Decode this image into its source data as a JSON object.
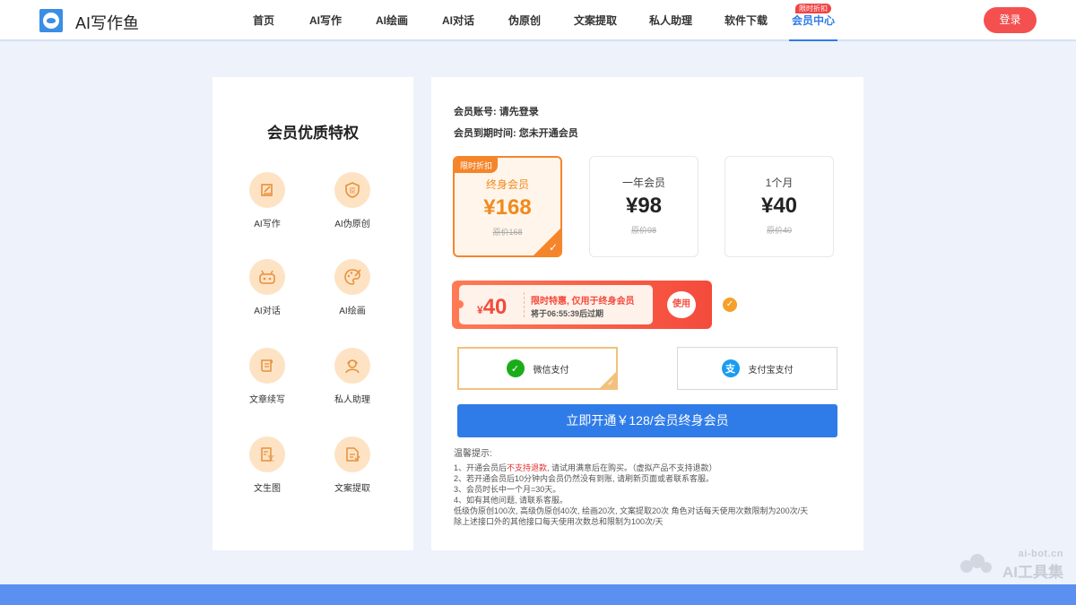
{
  "header": {
    "logo_text": "AI写作鱼",
    "nav": [
      {
        "label": "首页",
        "active": false,
        "badge": ""
      },
      {
        "label": "AI写作",
        "active": false,
        "badge": ""
      },
      {
        "label": "AI绘画",
        "active": false,
        "badge": ""
      },
      {
        "label": "AI对话",
        "active": false,
        "badge": ""
      },
      {
        "label": "伪原创",
        "active": false,
        "badge": ""
      },
      {
        "label": "文案提取",
        "active": false,
        "badge": ""
      },
      {
        "label": "私人助理",
        "active": false,
        "badge": ""
      },
      {
        "label": "软件下载",
        "active": false,
        "badge": ""
      },
      {
        "label": "会员中心",
        "active": true,
        "badge": "限时折扣"
      }
    ],
    "login_label": "登录"
  },
  "privileges": {
    "title": "会员优质特权",
    "items": [
      {
        "label": "AI写作",
        "icon": "pencil-icon"
      },
      {
        "label": "AI伪原创",
        "icon": "shield-original-icon"
      },
      {
        "label": "AI对话",
        "icon": "robot-icon"
      },
      {
        "label": "AI绘画",
        "icon": "palette-icon"
      },
      {
        "label": "文章续写",
        "icon": "scroll-icon"
      },
      {
        "label": "私人助理",
        "icon": "assistant-icon"
      },
      {
        "label": "文生图",
        "icon": "text-image-icon"
      },
      {
        "label": "文案提取",
        "icon": "document-extract-icon"
      }
    ]
  },
  "account": {
    "account_line": "会员账号: 请先登录",
    "expiry_line": "会员到期时间: 您未开通会员"
  },
  "plans": [
    {
      "tag": "限时折扣",
      "name": "终身会员",
      "price": "¥168",
      "original": "原价168",
      "selected": true
    },
    {
      "tag": "",
      "name": "一年会员",
      "price": "¥98",
      "original": "原价98",
      "selected": false
    },
    {
      "tag": "",
      "name": "1个月",
      "price": "¥40",
      "original": "原价40",
      "selected": false
    }
  ],
  "coupon": {
    "currency": "¥",
    "amount": "40",
    "text": "限时特惠, 仅用于终身会员",
    "countdown": "将于06:55:39后过期",
    "use_label": "使用"
  },
  "payment": {
    "wechat_label": "微信支付",
    "alipay_label": "支付宝支付",
    "selected": "wechat"
  },
  "open_button": "立即开通￥128/会员终身会员",
  "tips": {
    "title": "温馨提示:",
    "line1_a": "1、开通会员后",
    "line1_red": "不支持退款",
    "line1_b": ", 请试用满意后在购买。（虚拟产品不支持退款）",
    "line2": "2、若开通会员后10分钟内会员仍然没有到账, 请刷新页面或者联系客服。",
    "line3": "3、会员时长中一个月=30天。",
    "line4": "4、如有其他问题, 请联系客服。",
    "line5": "低级伪原创100次, 高级伪原创40次, 绘画20次, 文案提取20次 角色对话每天使用次数限制为200次/天",
    "line6": "除上述接口外的其他接口每天使用次数总和限制为100次/天"
  },
  "watermark": {
    "url": "ai-bot.cn",
    "name": "AI工具集"
  },
  "colors": {
    "primary": "#2f7ce8",
    "orange": "#f5852a",
    "red": "#f44a3c",
    "background": "#eef2fb"
  }
}
